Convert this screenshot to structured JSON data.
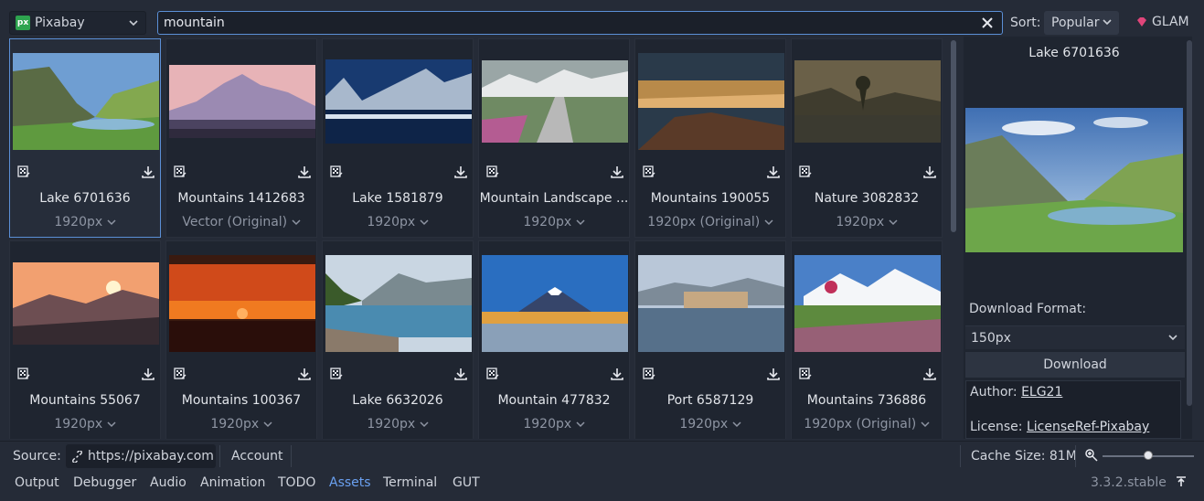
{
  "topbar": {
    "source_logo": "px",
    "source": "Pixabay",
    "search_value": "mountain",
    "sort_label": "Sort:",
    "sort_value": "Popular",
    "glam_label": "GLAM"
  },
  "icons": {
    "source_chevron": "chevron-down-icon",
    "clear": "close-icon",
    "glam": "gem-icon",
    "license": "license-icon",
    "download": "download-icon",
    "link": "link-icon",
    "zoom": "zoom-in-icon",
    "pin": "pin-icon"
  },
  "colors": {
    "accent": "#5b8fd6",
    "active_tab": "#6aa0f0",
    "glam": "#e0457a"
  },
  "grid": {
    "items": [
      {
        "title": "Lake 6701636",
        "size": "1920px",
        "selected": true
      },
      {
        "title": "Mountains 1412683",
        "size": "Vector (Original)"
      },
      {
        "title": "Lake 1581879",
        "size": "1920px"
      },
      {
        "title": "Mountain Landscape ...",
        "size": "1920px"
      },
      {
        "title": "Mountains 190055",
        "size": "1920px (Original)"
      },
      {
        "title": "Nature 3082832",
        "size": "1920px"
      },
      {
        "title": "Mountains 55067",
        "size": "1920px"
      },
      {
        "title": "Mountains 100367",
        "size": "1920px"
      },
      {
        "title": "Lake 6632026",
        "size": "1920px"
      },
      {
        "title": "Mountain 477832",
        "size": "1920px"
      },
      {
        "title": "Port 6587129",
        "size": "1920px"
      },
      {
        "title": "Mountains 736886",
        "size": "1920px (Original)"
      }
    ]
  },
  "preview": {
    "title": "Lake 6701636",
    "download_format_label": "Download Format:",
    "download_format_value": "150px",
    "download_button": "Download",
    "author_label": "Author:",
    "author": "ELG21",
    "license_label": "License:",
    "license": "LicenseRef-Pixabay"
  },
  "statusbar": {
    "source_label": "Source:",
    "source_url": "https://pixabay.com",
    "account": "Account",
    "cache": "Cache Size: 81M"
  },
  "zoom_level": 0.5,
  "dock": {
    "tabs": [
      "Output",
      "Debugger",
      "Audio",
      "Animation",
      "TODO",
      "Assets",
      "Terminal",
      "GUT"
    ],
    "active": "Assets",
    "version": "3.3.2.stable"
  }
}
